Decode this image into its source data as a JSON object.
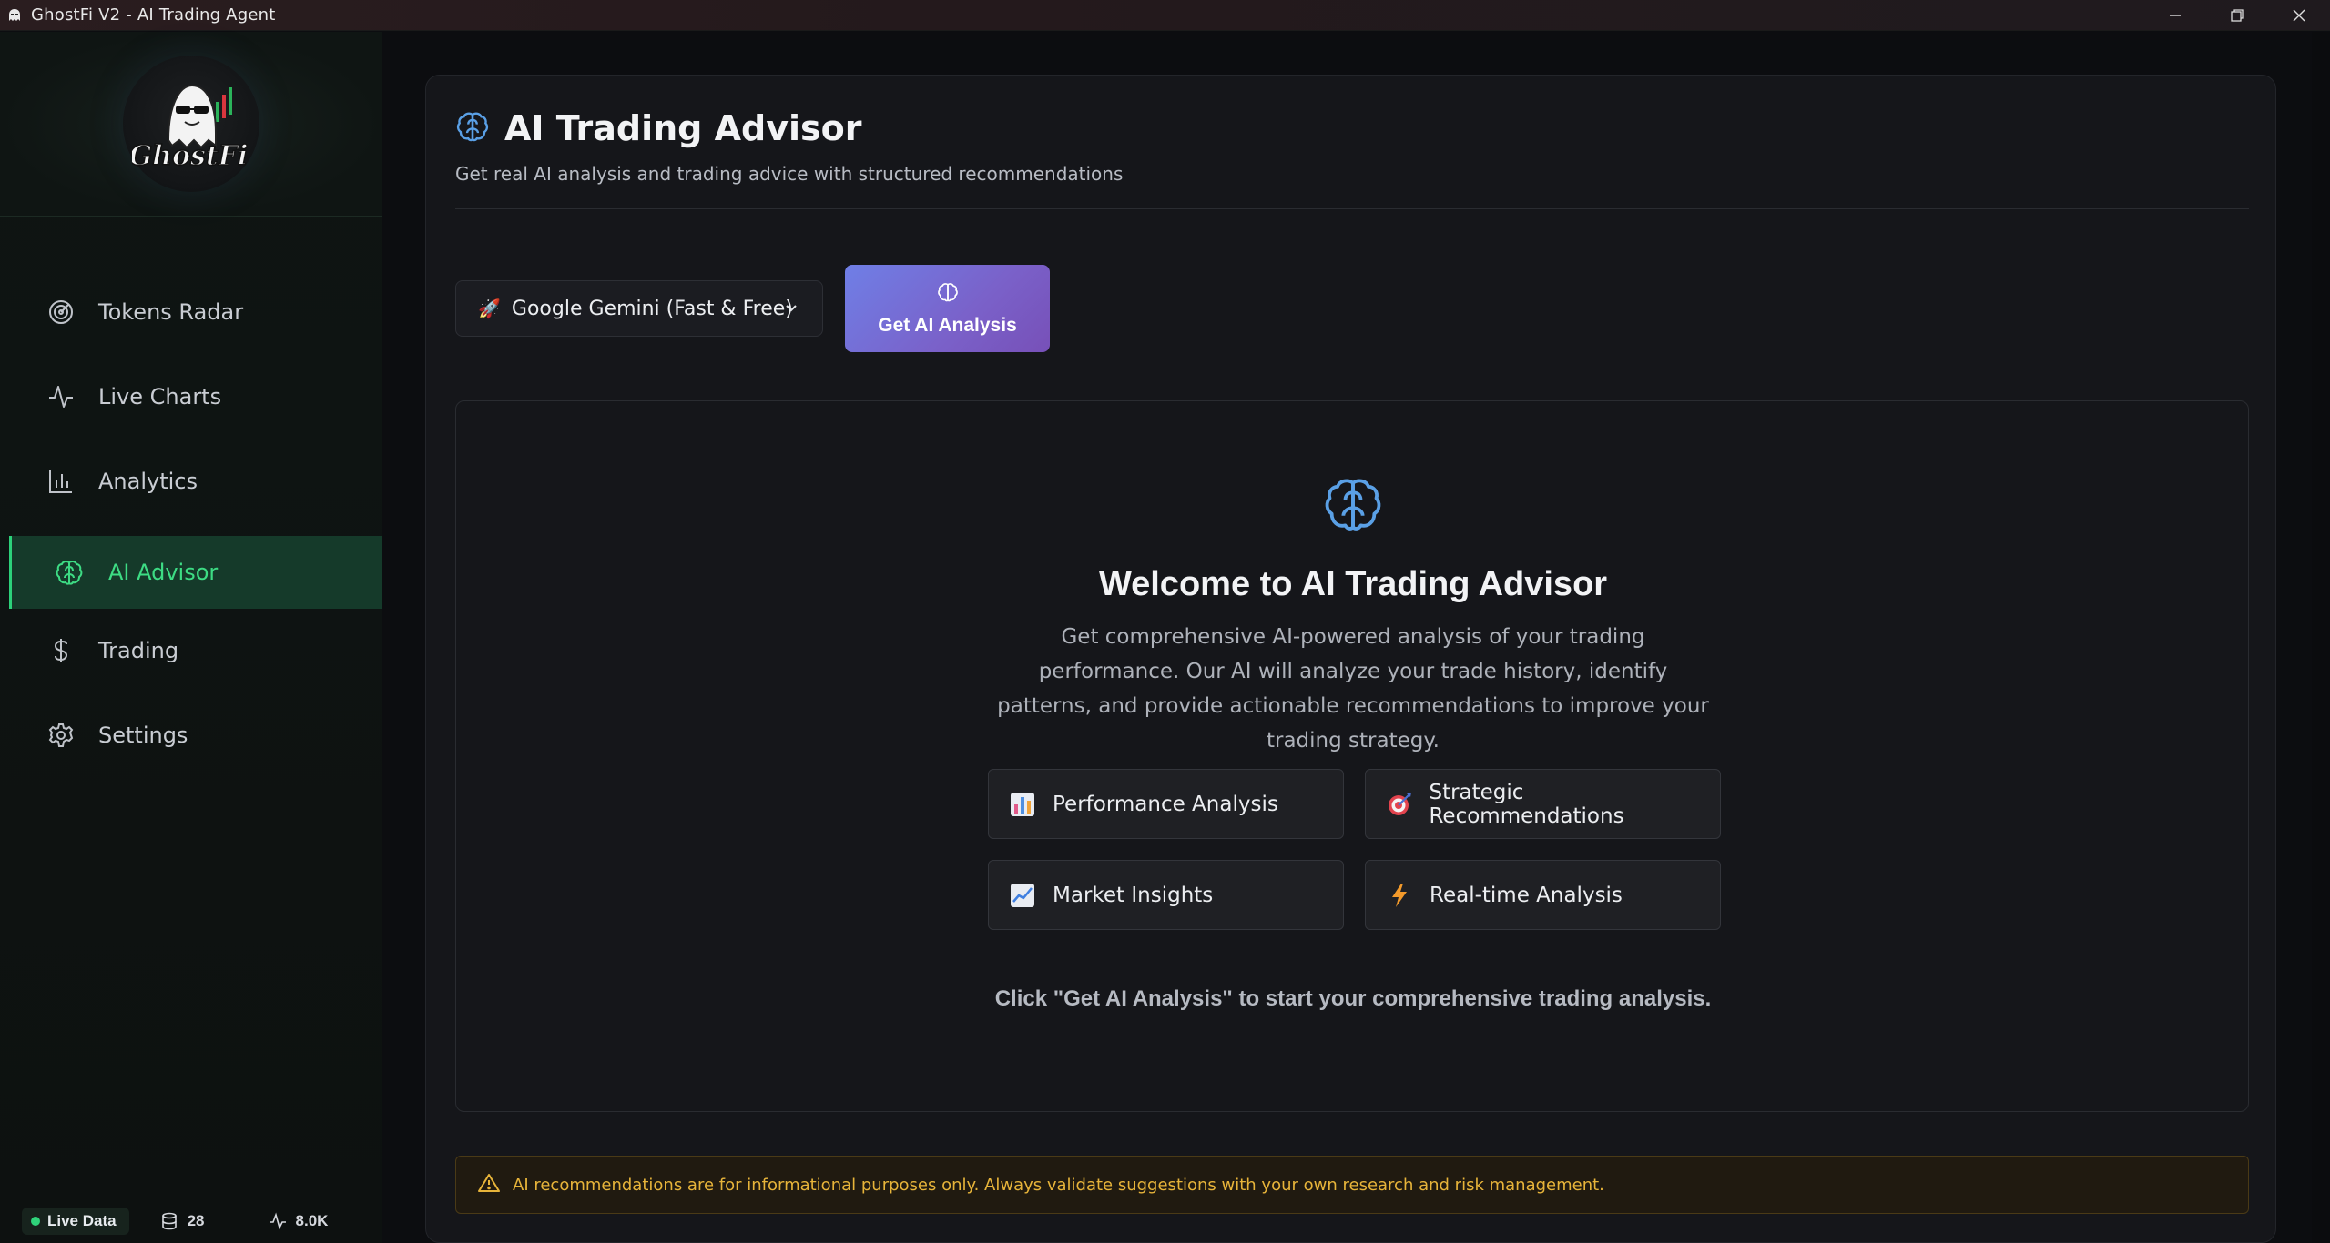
{
  "window": {
    "title": "GhostFi V2 - AI Trading Agent"
  },
  "sidebar": {
    "logo_text": "GhostFi",
    "items": [
      {
        "label": "Tokens Radar",
        "icon": "radar-icon"
      },
      {
        "label": "Live Charts",
        "icon": "activity-icon"
      },
      {
        "label": "Analytics",
        "icon": "bar-chart-icon"
      },
      {
        "label": "AI Advisor",
        "icon": "brain-icon",
        "active": true
      },
      {
        "label": "Trading",
        "icon": "dollar-icon"
      },
      {
        "label": "Settings",
        "icon": "gear-icon"
      }
    ],
    "status": {
      "live_label": "Live Data",
      "db_count": "28",
      "activity_value": "8.0K"
    }
  },
  "main": {
    "title": "AI Trading Advisor",
    "subtitle": "Get real AI analysis and trading advice with structured recommendations",
    "model_select": {
      "selected": "Google Gemini (Fast & Free)",
      "icon": "rocket-icon"
    },
    "analyze_button": "Get AI Analysis",
    "welcome": {
      "title": "Welcome to AI Trading Advisor",
      "description": "Get comprehensive AI-powered analysis of your trading performance. Our AI will analyze your trade history, identify patterns, and provide actionable recommendations to improve your trading strategy.",
      "features": [
        {
          "label": "Performance Analysis",
          "icon": "bar-chart-emoji-icon"
        },
        {
          "label": "Strategic Recommendations",
          "icon": "target-icon"
        },
        {
          "label": "Market Insights",
          "icon": "trend-up-icon"
        },
        {
          "label": "Real-time Analysis",
          "icon": "lightning-icon"
        }
      ],
      "cta": "Click \"Get AI Analysis\" to start your comprehensive trading analysis."
    },
    "disclaimer": "AI recommendations are for informational purposes only. Always validate suggestions with your own research and risk management."
  },
  "colors": {
    "accent_green": "#3ddc84",
    "brand_blue": "#5aa0e6",
    "button_gradient_start": "#6f7fe6",
    "button_gradient_end": "#7750b8",
    "warning": "#e7b43a"
  }
}
